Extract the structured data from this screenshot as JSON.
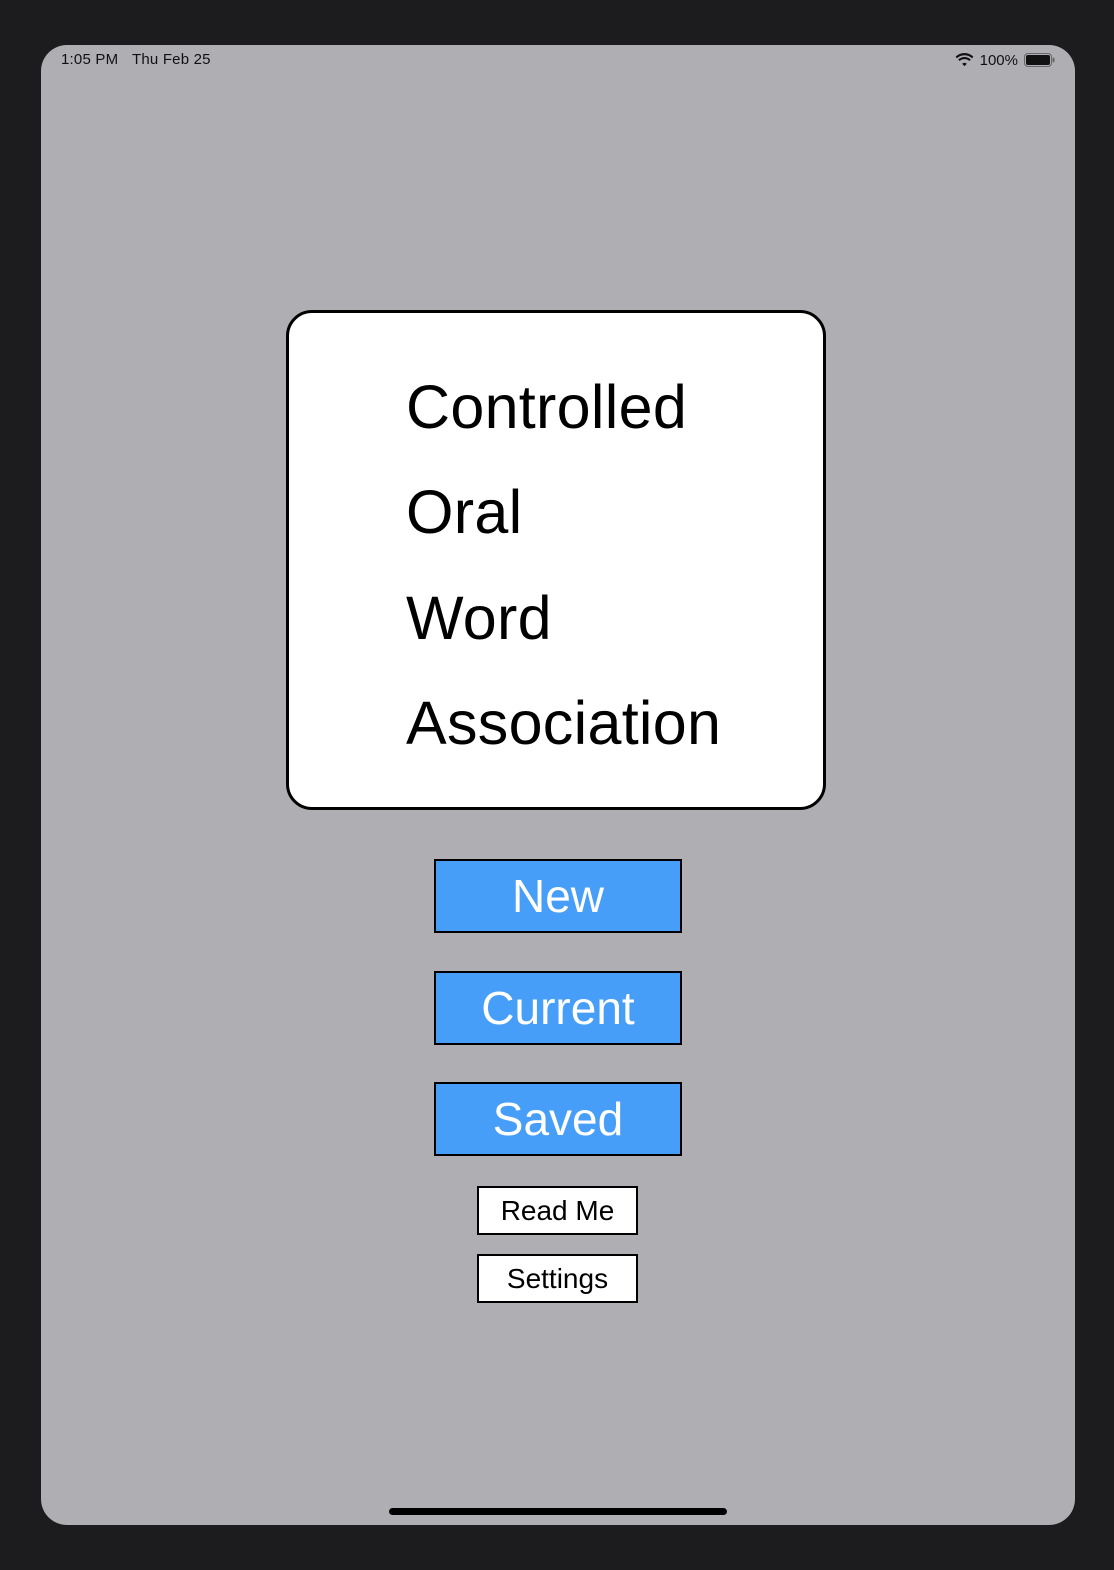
{
  "status_bar": {
    "time": "1:05 PM",
    "date": "Thu Feb 25",
    "battery_percent": "100%",
    "icons": [
      "wifi-icon",
      "battery-icon"
    ]
  },
  "title_card": {
    "lines": [
      "Controlled",
      "Oral",
      "Word",
      "Association"
    ]
  },
  "buttons": {
    "new_label": "New",
    "current_label": "Current",
    "saved_label": "Saved",
    "readme_label": "Read Me",
    "settings_label": "Settings"
  },
  "colors": {
    "background": "#afaeb3",
    "primary_button": "#479ef8",
    "primary_button_text": "#ffffff",
    "card_background": "#ffffff",
    "border": "#000000"
  }
}
